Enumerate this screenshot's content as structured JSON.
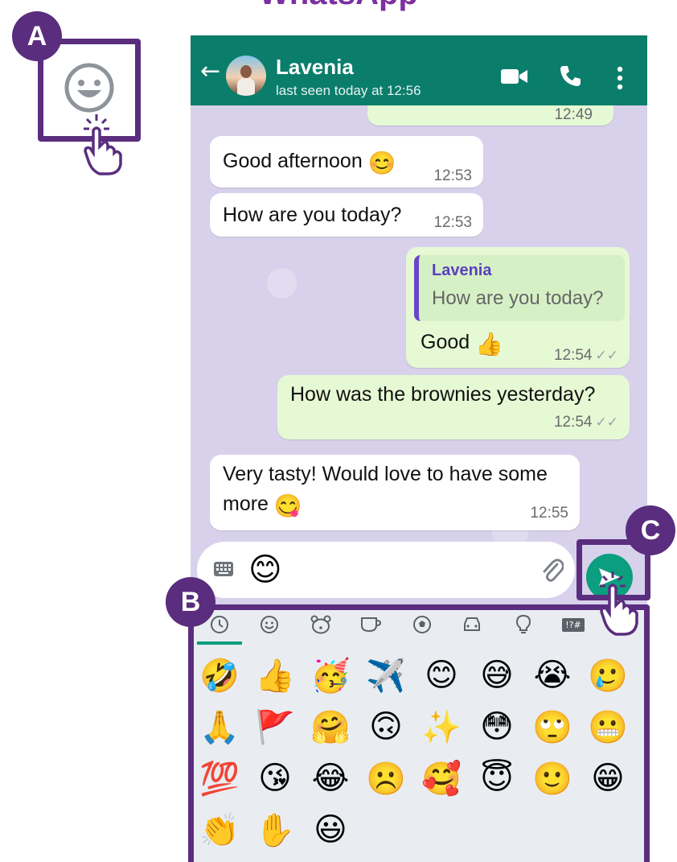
{
  "title": "WhatsApp",
  "callouts": {
    "a": "A",
    "b": "B",
    "c": "C"
  },
  "chat": {
    "contact_name": "Lavenia",
    "status": "last seen today at 12:56",
    "partial_time": "12:49",
    "messages": [
      {
        "text": "Good afternoon",
        "emoji": "😊",
        "time": "12:53"
      },
      {
        "text": "How are you today?",
        "time": "12:53"
      },
      {
        "quote_name": "Lavenia",
        "quote_text": "How are you today?",
        "text": "Good",
        "emoji": "👍",
        "time": "12:54"
      },
      {
        "text": "How was the brownies yesterday?",
        "time": "12:54"
      },
      {
        "line1": "Very tasty! Would love to have some",
        "line2": "more",
        "emoji": "😋",
        "time": "12:55"
      }
    ]
  },
  "input": {
    "value_emoji": "😊",
    "keyboard_icon": "keyboard-icon",
    "attach_icon": "paperclip-icon"
  },
  "keyboard": {
    "tabs": [
      "recent",
      "smileys",
      "animals",
      "food",
      "activity",
      "travel",
      "objects",
      "symbols"
    ],
    "symbols_label": "!?#",
    "emojis": [
      "🤣",
      "👍",
      "🥳",
      "✈️",
      "😊",
      "😅",
      "😭",
      "🥲",
      "🙏",
      "🚩",
      "🤗",
      "🙃",
      "✨",
      "😳",
      "🙄",
      "😬",
      "💯",
      "😘",
      "😂",
      "☹️",
      "🥰",
      "😇",
      "🙂",
      "😁",
      "👏",
      "✋",
      "😃"
    ]
  },
  "colors": {
    "header": "#0b7d6b",
    "accent": "#0b9e7f",
    "outline": "#5a2d7e"
  }
}
